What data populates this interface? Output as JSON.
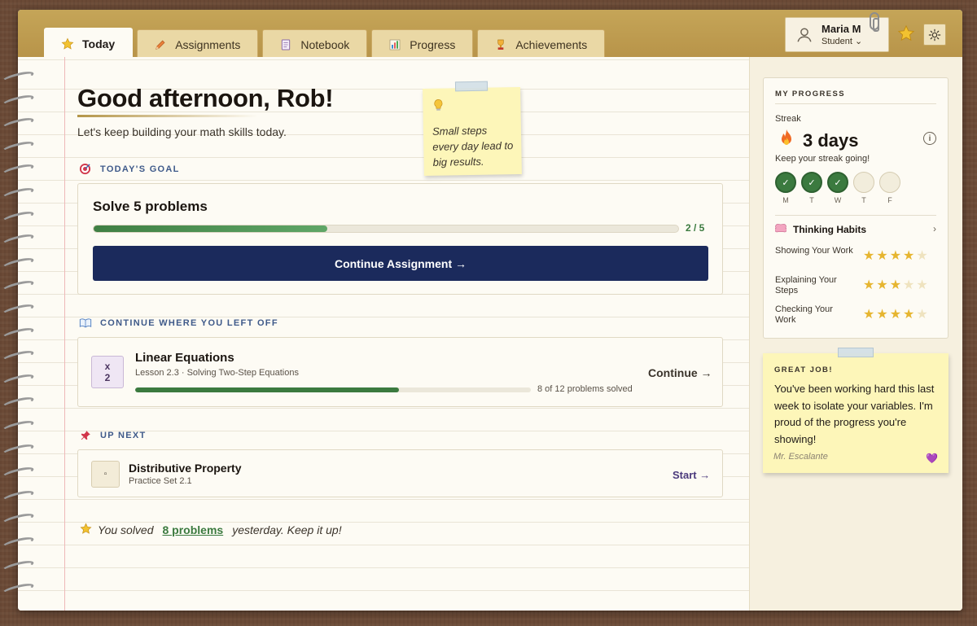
{
  "tabs": [
    {
      "label": "Today",
      "icon": "star-icon",
      "active": true
    },
    {
      "label": "Assignments",
      "icon": "pencil-icon",
      "active": false
    },
    {
      "label": "Notebook",
      "icon": "notebook-icon",
      "active": false
    },
    {
      "label": "Progress",
      "icon": "bar-chart-icon",
      "active": false
    },
    {
      "label": "Achievements",
      "icon": "trophy-icon",
      "active": false
    }
  ],
  "user": {
    "name": "Maria M",
    "role": "Student",
    "role_chevron": "⌄"
  },
  "greeting": {
    "title": "Good afternoon, Rob!",
    "subtitle": "Let's keep building your math skills today."
  },
  "sticky_note": {
    "text": "Small steps every day lead to big results."
  },
  "todays_goal": {
    "section_title": "TODAY'S GOAL",
    "title": "Solve 5 problems",
    "progress": 0.4,
    "count": "2 / 5",
    "button_label": "Continue Assignment →"
  },
  "continue_section": {
    "section_title": "CONTINUE WHERE YOU LEFT OFF",
    "icon_top": "x",
    "icon_bottom": "2",
    "title": "Linear Equations",
    "subtitle": "Lesson 2.3 · Solving Two-Step Equations",
    "progress": 0.6667,
    "count": "8 of 12 problems solved",
    "action": "Continue →"
  },
  "up_next": {
    "section_title": "UP NEXT",
    "icon": "▫",
    "title": "Distributive Property",
    "subtitle": "Practice Set 2.1",
    "action": "Start →"
  },
  "footer": {
    "prefix": "You solved",
    "link": "8 problems",
    "suffix": "yesterday. Keep it up!"
  },
  "my_progress": {
    "heading": "MY PROGRESS",
    "streak_label": "Streak",
    "streak_value": "3 days",
    "streak_note": "Keep your streak going!",
    "info": "i",
    "days": [
      {
        "label": "M",
        "done": true,
        "mark": "✓"
      },
      {
        "label": "T",
        "done": true,
        "mark": "✓"
      },
      {
        "label": "W",
        "done": true,
        "mark": "✓"
      },
      {
        "label": "T",
        "done": false,
        "mark": ""
      },
      {
        "label": "F",
        "done": false,
        "mark": ""
      }
    ],
    "habits_title": "Thinking Habits",
    "habits_chevron": "›",
    "habits": [
      {
        "name": "Showing Your Work",
        "rating": 4,
        "max": 5
      },
      {
        "name": "Explaining Your Steps",
        "rating": 3,
        "max": 5
      },
      {
        "name": "Checking Your Work",
        "rating": 4,
        "max": 5
      }
    ]
  },
  "teacher_note": {
    "heading": "GREAT JOB!",
    "body": "You've been working hard this last week to isolate your variables. I'm proud of the progress you're showing!",
    "signature": "Mr. Escalante",
    "heart": "💜"
  },
  "colors": {
    "accent": "#1b2a5c",
    "success": "#3b7a3f",
    "header": "#c5a558",
    "sticky": "#fdf6b9"
  }
}
